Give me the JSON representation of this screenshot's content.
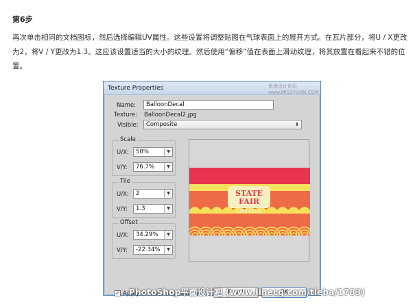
{
  "article": {
    "step_title": "第6步",
    "paragraph": "再次单击相同的文档图标，然后选择编辑UV属性。这些设置将调整贴图在气球表面上的展开方式。在瓦片部分，将U / X更改为2，将V / Y更改为1.3。这应该设置适当的大小的纹理。然后使用“偏移”值在表面上滑动纹理，将其放置在看起来不错的位置。"
  },
  "dialog": {
    "title": "Texture Properties",
    "watermark": "思缘设计论坛 www.MISSYUAN.COM",
    "name_label": "Name:",
    "name_value": "BalloonDecal",
    "texture_label": "Texture:",
    "texture_value": "BalloonDecal2.jpg",
    "visible_label": "Visible:",
    "visible_value": "Composite",
    "scale": {
      "title": "Scale",
      "u_label": "U/X:",
      "u_value": "50%",
      "v_label": "V/Y:",
      "v_value": "76.7%"
    },
    "tile": {
      "title": "Tile",
      "u_label": "U/X:",
      "u_value": "2",
      "v_label": "V/Y:",
      "v_value": "1.3"
    },
    "offset": {
      "title": "Offset",
      "u_label": "U/X:",
      "u_value": "34.29%",
      "v_label": "V/Y:",
      "v_value": "-22.34%"
    },
    "apply_checkbox_label": "Apply to matching textures",
    "apply_checked": true,
    "reset_button": "Reset",
    "ok_button": "OK",
    "preview": {
      "line1": "STATE",
      "line2": "FAIR",
      "line3": "OMAHA",
      "colors": {
        "red": "#e8344f",
        "orange": "#ef6a46",
        "yellow": "#f6e15a",
        "cream": "#f6f0c0"
      }
    }
  },
  "footer_watermark": "PhotoShop平面设计吧 (www.linecg.com/tieba/1783)"
}
